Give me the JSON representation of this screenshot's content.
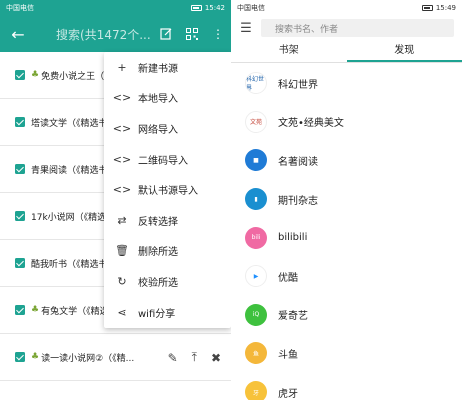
{
  "left": {
    "status": {
      "carrier": "中国电信",
      "time": "15:42"
    },
    "toolbar": {
      "back_icon": "arrow-back-icon",
      "search_placeholder": "搜索(共1472个...",
      "icons": [
        "edit-icon",
        "qr-scan-icon",
        "more-vert-icon"
      ]
    },
    "rows": [
      {
        "label": "免费小说之王（",
        "leaf": true
      },
      {
        "label": "塔读文学（《精选书",
        "leaf": false
      },
      {
        "label": "青果阅读（《精选书",
        "leaf": false
      },
      {
        "label": "17k小说网（《精选",
        "leaf": false
      },
      {
        "label": "酷我听书（《精选书",
        "leaf": false
      },
      {
        "label": "有兔文学（《精选",
        "leaf": true
      },
      {
        "label": "读一读小说网②（《精...",
        "leaf": true
      }
    ],
    "row_actions": [
      "edit-icon",
      "to-top-icon",
      "delete-icon"
    ],
    "menu": [
      {
        "icon": "plus-icon",
        "glyph": "+",
        "label": "新建书源"
      },
      {
        "icon": "code-icon",
        "glyph": "<>",
        "label": "本地导入"
      },
      {
        "icon": "code-icon",
        "glyph": "<>",
        "label": "网络导入"
      },
      {
        "icon": "code-icon",
        "glyph": "<>",
        "label": "二维码导入"
      },
      {
        "icon": "code-icon",
        "glyph": "<>",
        "label": "默认书源导入"
      },
      {
        "icon": "swap-icon",
        "glyph": "⇄",
        "label": "反转选择"
      },
      {
        "icon": "trash-icon",
        "glyph": "🗑",
        "label": "删除所选"
      },
      {
        "icon": "verify-icon",
        "glyph": "↻",
        "label": "校验所选"
      },
      {
        "icon": "share-icon",
        "glyph": "⋖",
        "label": "wifi分享"
      }
    ]
  },
  "right": {
    "status": {
      "carrier": "中国电信",
      "time": "15:49"
    },
    "search_placeholder": "搜索书名、作者",
    "tabs": [
      {
        "label": "书架",
        "active": false
      },
      {
        "label": "发现",
        "active": true
      }
    ],
    "sources": [
      {
        "name": "科幻世界",
        "logo_color": "#ffffff",
        "logo_text": "科幻世界",
        "logo_text_color": "#1b5fa8"
      },
      {
        "name": "文苑•经典美文",
        "logo_color": "#ffffff",
        "logo_text": "文苑",
        "logo_text_color": "#c0392b"
      },
      {
        "name": "名著阅读",
        "logo_color": "#1f7bd6",
        "logo_text": "■",
        "logo_text_color": "#ffffff"
      },
      {
        "name": "期刊杂志",
        "logo_color": "#1a8fd0",
        "logo_text": "▮",
        "logo_text_color": "#ffffff"
      },
      {
        "name": "bilibili",
        "logo_color": "#f06aa3",
        "logo_text": "bili",
        "logo_text_color": "#ffffff"
      },
      {
        "name": "优酷",
        "logo_color": "#ffffff",
        "logo_text": "▶",
        "logo_text_color": "#1e90ff"
      },
      {
        "name": "爱奇艺",
        "logo_color": "#3ec13e",
        "logo_text": "iQ",
        "logo_text_color": "#ffffff"
      },
      {
        "name": "斗鱼",
        "logo_color": "#f4b73a",
        "logo_text": "鱼",
        "logo_text_color": "#ffffff"
      },
      {
        "name": "虎牙",
        "logo_color": "#f7c23a",
        "logo_text": "牙",
        "logo_text_color": "#ffffff"
      }
    ]
  },
  "colors": {
    "accent": "#1ea392"
  }
}
